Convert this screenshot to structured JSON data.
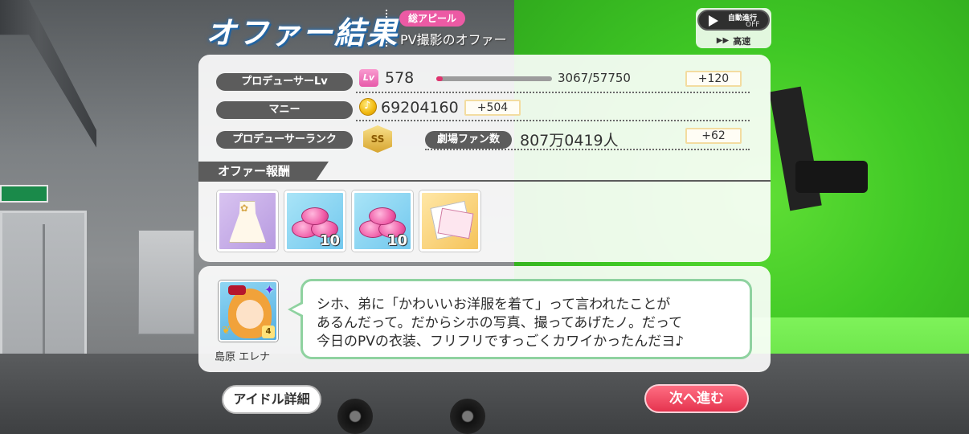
{
  "header": {
    "title": "オファー結果",
    "appeal_badge": "総アピール",
    "offer_name": "PV撮影のオファー",
    "auto_label": "自動進行",
    "auto_state": "OFF",
    "speed_label": "高速"
  },
  "stats": {
    "producer_lv_label": "プロデューサーLv",
    "lv_icon": "Lv",
    "lv_value": "578",
    "lv_progress": "3067/57750",
    "lv_progress_fraction": 0.053,
    "lv_gain": "+120",
    "money_label": "マニー",
    "money_value": "69204160",
    "money_gain": "+504",
    "rank_label": "プロデューサーランク",
    "rank_badge": "SS",
    "fans_label": "劇場ファン数",
    "fans_value": "807万0419人",
    "fans_gain": "+62"
  },
  "rewards": {
    "title": "オファー報酬",
    "items": [
      {
        "icon": "dress-icon",
        "count": ""
      },
      {
        "icon": "candy-icon",
        "count": "10"
      },
      {
        "icon": "candy-icon",
        "count": "10"
      },
      {
        "icon": "letter-icon",
        "count": ""
      }
    ]
  },
  "dialogue": {
    "idol_name": "島原 エレナ",
    "rank": "4",
    "lines": [
      "シホ、弟に「かわいいお洋服を着て」って言われたことが",
      "あるんだって。だからシホの写真、撮ってあげたノ。だって",
      "今日のPVの衣装、フリフリですっごくカワイかったんだヨ♪"
    ]
  },
  "buttons": {
    "detail": "アイドル詳細",
    "next": "次へ進む"
  },
  "colors": {
    "accent_pink": "#ec5aa4",
    "next_button": "#e5344f",
    "bubble_border": "#8fd2a0",
    "label_pill": "#5c5c5c"
  }
}
